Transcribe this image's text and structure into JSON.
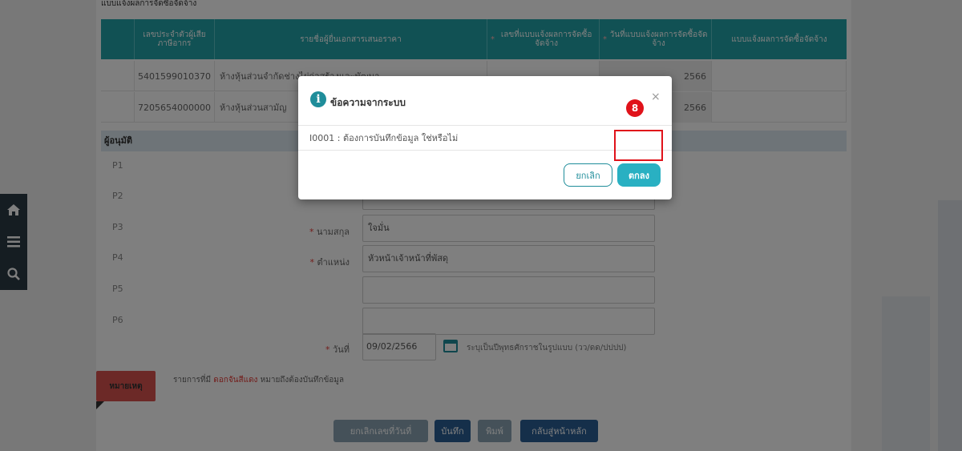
{
  "section_title": "แบบแจ้งผลการจัดซื้อจัดจ้าง",
  "table": {
    "headers": [
      {
        "label": "เลขประจำตัวผู้เสียภาษีอากร",
        "required": false
      },
      {
        "label": "รายชื่อผู้ยื่นเอกสารเสนอราคา",
        "required": false
      },
      {
        "label": "เลขที่แบบแจ้งผลการจัดซื้อจัดจ้าง",
        "required": true
      },
      {
        "label": "วันที่แบบแจ้งผลการจัดซื้อจัดจ้าง",
        "required": true
      },
      {
        "label": "แบบแจ้งผลการจัดซื้อจัดจ้าง",
        "required": false
      }
    ],
    "rows": [
      {
        "tax_id": "5401599010370",
        "name": "ห้างหุ้นส่วนจำกัดช่างไผ่ก่อสร้างและพัฒนา",
        "no": "",
        "date": "2566",
        "doc": ""
      },
      {
        "tax_id": "7205654000000",
        "name": "ห้างหุ้นส่วนสามัญ",
        "no": "",
        "date": "2566",
        "doc": ""
      }
    ]
  },
  "approver": {
    "section_label": "ผู้อนุมัติ",
    "p_labels": [
      "P1",
      "P2",
      "P3",
      "P4",
      "P5",
      "P6"
    ],
    "lastname_label": "นามสกุล",
    "lastname_value": "ใจมั่น",
    "position_label": "ตำแหน่ง",
    "position_value": "หัวหน้าเจ้าหน้าที่พัสดุ",
    "date_label": "วันที่",
    "date_value": "09/02/2566",
    "date_hint": "ระบุเป็นปีพุทธศักราชในรูปแบบ (วว/ดด/ปปปป)"
  },
  "note": {
    "badge": "หมายเหตุ",
    "text_prefix": "รายการที่มี",
    "text_red": "ดอกจันสีแดง",
    "text_suffix": "หมายถึงต้องบันทึกข้อมูล"
  },
  "bottom_buttons": {
    "cancel_date": "ยกเลิกเลขที่วันที่",
    "save": "บันทึก",
    "print": "พิมพ์",
    "back": "กลับสู่หน้าหลัก"
  },
  "dialog": {
    "title": "ข้อความจากระบบ",
    "close": "×",
    "message": "I0001 : ต้องการบันทึกข้อมูล ใช่หรือไม่",
    "cancel": "ยกเลิก",
    "ok": "ตกลง"
  },
  "annotation": {
    "number": "8"
  },
  "colors": {
    "header_teal": "#23a3a8",
    "ok_button": "#29b0c2",
    "note_red": "#d9534f",
    "annotation_red": "#e0121a",
    "float_bar": "#2b3a45"
  }
}
